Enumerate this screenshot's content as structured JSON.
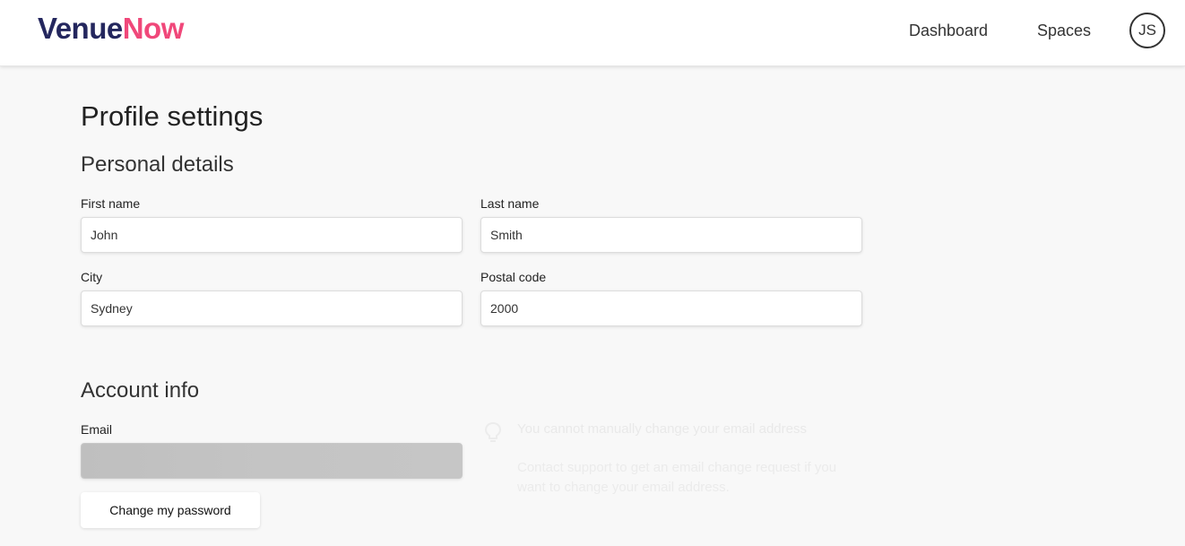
{
  "header": {
    "logo_part1": "Venue",
    "logo_part2": "Now",
    "nav": {
      "dashboard": "Dashboard",
      "spaces": "Spaces"
    },
    "avatar_initials": "JS"
  },
  "page": {
    "title": "Profile settings"
  },
  "personal": {
    "title": "Personal details",
    "first_name": {
      "label": "First name",
      "value": "John"
    },
    "last_name": {
      "label": "Last name",
      "value": "Smith"
    },
    "city": {
      "label": "City",
      "value": "Sydney"
    },
    "postal_code": {
      "label": "Postal code",
      "value": "2000"
    }
  },
  "account": {
    "title": "Account info",
    "email": {
      "label": "Email",
      "value": ""
    },
    "change_password_label": "Change my password",
    "notice": {
      "icon": "lightbulb-icon",
      "title": "You cannot manually change your email address",
      "body": "Contact support to get an email change request if you want to change your email address."
    }
  },
  "colors": {
    "brand_dark": "#24275e",
    "brand_accent": "#f0487a",
    "background": "#f8f8f8"
  }
}
